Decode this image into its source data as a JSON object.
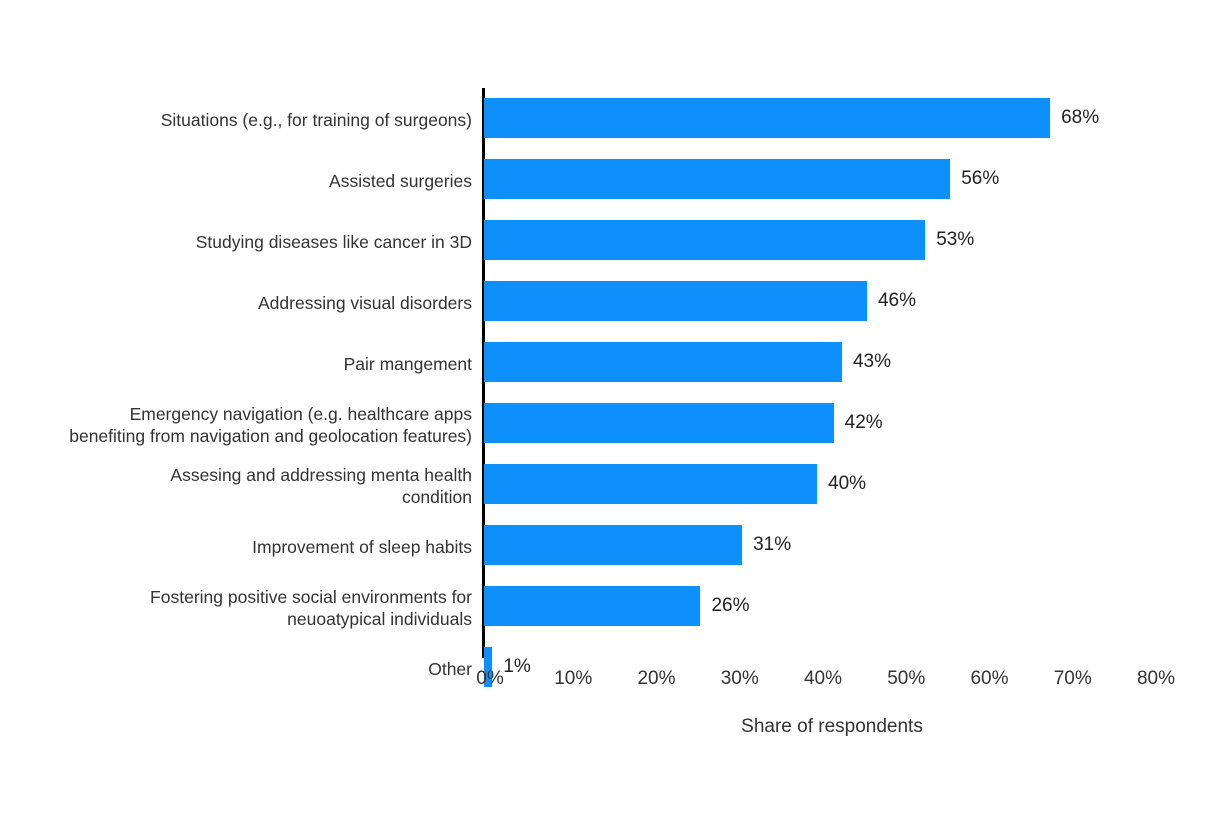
{
  "chart_data": {
    "type": "bar",
    "orientation": "horizontal",
    "title": "",
    "subtitle": "",
    "xlabel": "Share of respondents",
    "ylabel": "",
    "xlim": [
      0,
      80
    ],
    "grid": false,
    "legend": null,
    "bar_color": "#0d90fb",
    "text_color": "#333333",
    "background": "#ffffff",
    "x_ticks": [
      "0%",
      "10%",
      "20%",
      "30%",
      "40%",
      "50%",
      "60%",
      "70%",
      "80%"
    ],
    "x_tick_values": [
      0,
      10,
      20,
      30,
      40,
      50,
      60,
      70,
      80
    ],
    "categories": [
      "Situations (e.g., for training of surgeons)",
      "Assisted surgeries",
      "Studying diseases like cancer in 3D",
      "Addressing visual disorders",
      "Pair mangement",
      "Emergency navigation (e.g. healthcare apps\nbenefiting from navigation and geolocation features)",
      "Assesing and addressing menta health\ncondition",
      "Improvement of sleep habits",
      "Fostering positive social environments for\nneuoatypical individuals",
      "Other"
    ],
    "values": [
      68,
      56,
      53,
      46,
      43,
      42,
      40,
      31,
      26,
      1
    ],
    "value_labels": [
      "68%",
      "56%",
      "53%",
      "46%",
      "43%",
      "42%",
      "40%",
      "31%",
      "26%",
      "1%"
    ]
  }
}
